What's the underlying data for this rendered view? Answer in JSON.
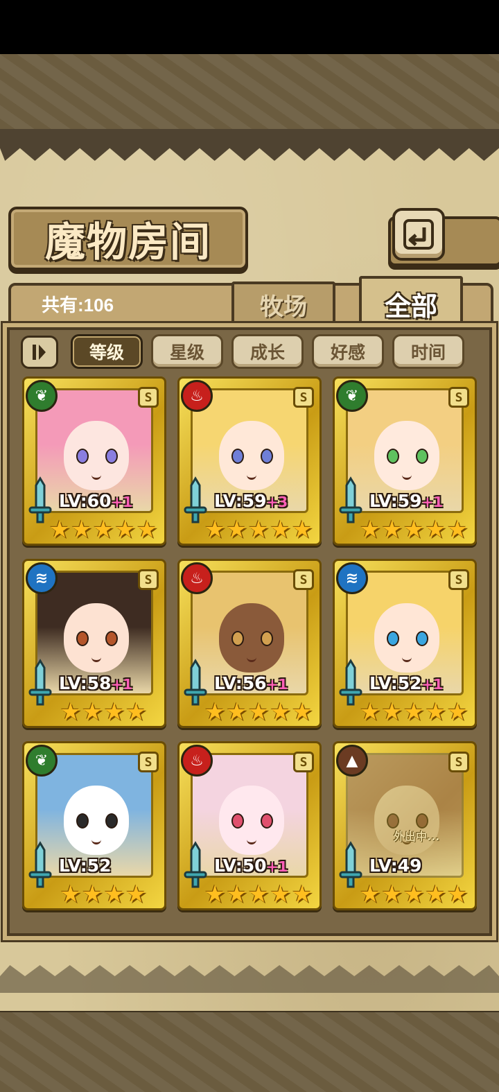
{
  "title": "魔物房间",
  "count_label": "共有:106",
  "tabs": [
    {
      "label": "牧场",
      "active": false
    },
    {
      "label": "全部",
      "active": true
    }
  ],
  "sort_buttons": [
    {
      "label": "等级",
      "active": true
    },
    {
      "label": "星级",
      "active": false
    },
    {
      "label": "成长",
      "active": false
    },
    {
      "label": "好感",
      "active": false
    },
    {
      "label": "时间",
      "active": false
    }
  ],
  "icons": {
    "back": "back-return-icon",
    "sort_toggle": "sort-order-icon",
    "sword": "sword-icon",
    "grade": "S"
  },
  "element_colors": {
    "leaf": "#2f7d2e",
    "fire": "#c7201c",
    "water": "#1f73c2",
    "earth": "#6b3b22"
  },
  "monsters": [
    {
      "element": "leaf",
      "level": "LV:60",
      "bonus": "+1",
      "stars": 5,
      "grade": "S",
      "hair": "#f49ab8",
      "skin": "#fde6e0",
      "eye": "#8a7ee0",
      "status": ""
    },
    {
      "element": "fire",
      "level": "LV:59",
      "bonus": "+3",
      "stars": 5,
      "grade": "S",
      "hair": "#f6d671",
      "skin": "#ffe8d8",
      "eye": "#6f7fd8",
      "status": ""
    },
    {
      "element": "leaf",
      "level": "LV:59",
      "bonus": "+1",
      "stars": 5,
      "grade": "S",
      "hair": "#f3cf82",
      "skin": "#ffeadd",
      "eye": "#5fc25f",
      "status": ""
    },
    {
      "element": "water",
      "level": "LV:58",
      "bonus": "+1",
      "stars": 4,
      "grade": "S",
      "hair": "#3e2c22",
      "skin": "#fde2d2",
      "eye": "#b4552a",
      "status": ""
    },
    {
      "element": "fire",
      "level": "LV:56",
      "bonus": "+1",
      "stars": 5,
      "grade": "S",
      "hair": "#e8c36f",
      "skin": "#8a5a3a",
      "eye": "#d2a050",
      "status": ""
    },
    {
      "element": "water",
      "level": "LV:52",
      "bonus": "+1",
      "stars": 5,
      "grade": "S",
      "hair": "#f6d36a",
      "skin": "#ffe6d6",
      "eye": "#3aa6e0",
      "status": ""
    },
    {
      "element": "leaf",
      "level": "LV:52",
      "bonus": "",
      "stars": 4,
      "grade": "S",
      "hair": "#7fb4e0",
      "skin": "#ffffff",
      "eye": "#2a2a2a",
      "status": ""
    },
    {
      "element": "fire",
      "level": "LV:50",
      "bonus": "+1",
      "stars": 5,
      "grade": "S",
      "hair": "#f4d4e0",
      "skin": "#ffe8ee",
      "eye": "#e0506e",
      "status": ""
    },
    {
      "element": "earth",
      "level": "LV:49",
      "bonus": "",
      "stars": 5,
      "grade": "S",
      "hair": "#c46a4a",
      "skin": "#e7c2a8",
      "eye": "#a04040",
      "status": "外出中..."
    }
  ]
}
